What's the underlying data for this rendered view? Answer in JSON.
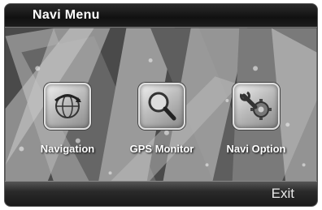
{
  "header": {
    "title": "Navi  Menu"
  },
  "menu": {
    "items": [
      {
        "label": "Navigation",
        "icon": "globe-navigation-icon"
      },
      {
        "label": "GPS Monitor",
        "icon": "magnifier-icon"
      },
      {
        "label": "Navi Option",
        "icon": "wrench-gear-icon"
      }
    ]
  },
  "footer": {
    "exit_label": "Exit"
  }
}
